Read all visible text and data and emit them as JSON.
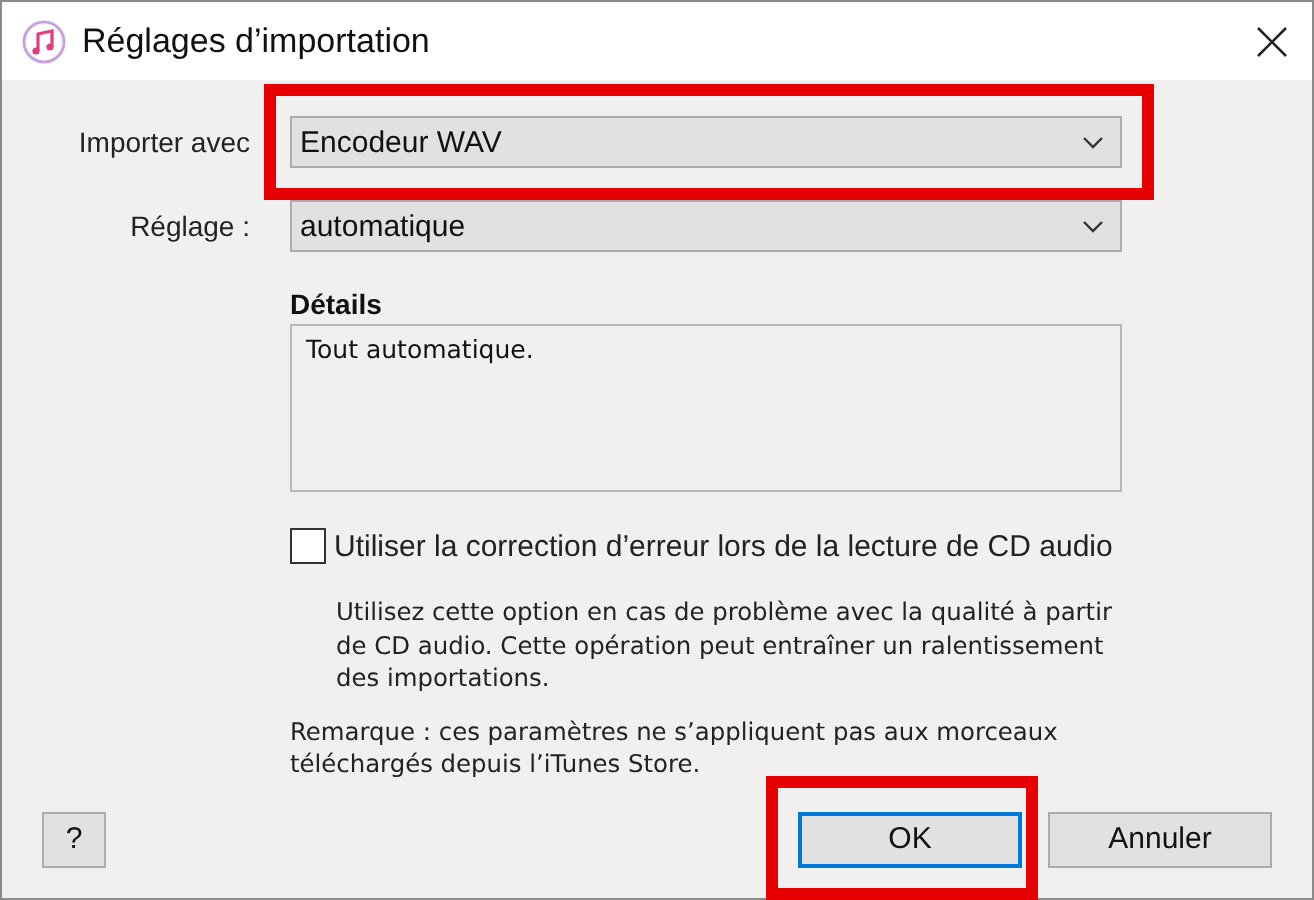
{
  "window": {
    "title": "Réglages d’importation"
  },
  "fields": [
    {
      "label": "Importer avec",
      "value": "Encodeur WAV",
      "highlighted": true
    },
    {
      "label": "Réglage :",
      "value": "automatique",
      "highlighted": false
    }
  ],
  "details": {
    "heading": "Détails",
    "text": "Tout automatique."
  },
  "option": {
    "label": "Utiliser la correction d’erreur lors de la lecture de CD audio",
    "checked": false,
    "description": "Utilisez cette option en cas de problème avec la qualité à partir de CD audio. Cette opération peut entraîner un ralentissement des importations."
  },
  "note": "Remarque : ces paramètres ne s’appliquent pas aux morceaux téléchargés depuis l’iTunes Store.",
  "help_button": "?",
  "buttons": [
    {
      "label": "OK",
      "default": true,
      "highlighted": true
    },
    {
      "label": "Annuler",
      "default": false,
      "highlighted": false
    }
  ]
}
